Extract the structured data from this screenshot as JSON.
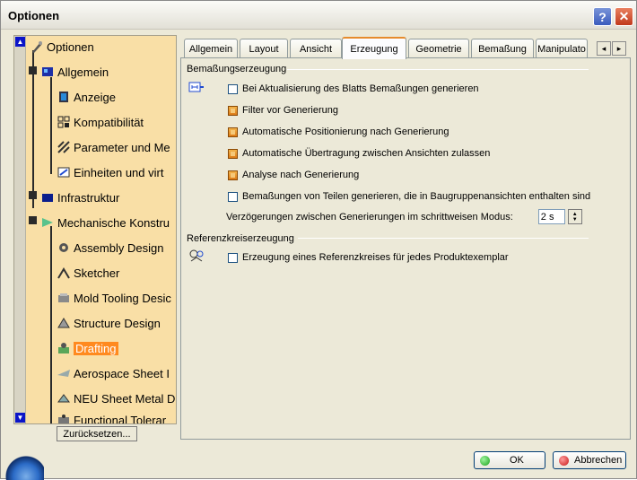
{
  "window": {
    "title": "Optionen",
    "help_label": "?",
    "close_label": "✕"
  },
  "tree": {
    "scroll_up": "▲",
    "scroll_down": "▼",
    "items": [
      {
        "label": "Optionen",
        "icon": "options-root-icon"
      },
      {
        "label": "Allgemein",
        "icon": "general-icon"
      },
      {
        "label": "Anzeige",
        "icon": "display-icon"
      },
      {
        "label": "Kompatibilität",
        "icon": "compatibility-icon"
      },
      {
        "label": "Parameter und Me",
        "icon": "parameters-icon"
      },
      {
        "label": "Einheiten und virt",
        "icon": "units-icon"
      },
      {
        "label": "Infrastruktur",
        "icon": "infrastructure-icon"
      },
      {
        "label": "Mechanische Konstru",
        "icon": "mechanical-design-icon"
      },
      {
        "label": "Assembly Design",
        "icon": "assembly-design-icon"
      },
      {
        "label": "Sketcher",
        "icon": "sketcher-icon"
      },
      {
        "label": "Mold Tooling Desic",
        "icon": "mold-tooling-icon"
      },
      {
        "label": "Structure Design",
        "icon": "structure-design-icon"
      },
      {
        "label": "Drafting",
        "icon": "drafting-icon"
      },
      {
        "label": "Aerospace Sheet I",
        "icon": "aerospace-sheet-icon"
      },
      {
        "label": "NEU Sheet Metal D",
        "icon": "sheet-metal-icon"
      },
      {
        "label": "Functional Tolerar",
        "icon": "functional-tolerancing-icon"
      }
    ],
    "selected": "Drafting",
    "reset_label": "Zurücksetzen..."
  },
  "tabs": {
    "items": [
      "Allgemein",
      "Layout",
      "Ansicht",
      "Erzeugung",
      "Geometrie",
      "Bemaßung",
      "Manipulato"
    ],
    "active": "Erzeugung",
    "scroll_left": "◂",
    "scroll_right": "▸"
  },
  "panel": {
    "section1": {
      "title": "Bemaßungserzeugung",
      "options": [
        {
          "label": "Bei Aktualisierung des Blatts Bemaßungen generieren",
          "checked": false
        },
        {
          "label": "Filter vor Generierung",
          "checked": true
        },
        {
          "label": "Automatische Positionierung nach Generierung",
          "checked": true
        },
        {
          "label": "Automatische Übertragung zwischen Ansichten zulassen",
          "checked": true
        },
        {
          "label": "Analyse nach Generierung",
          "checked": true
        },
        {
          "label": "Bemaßungen von Teilen generieren, die in Baugruppenansichten enthalten sind",
          "checked": false
        }
      ],
      "delay_label": "Verzögerungen zwischen Generierungen im schrittweisen Modus:",
      "delay_value": "2 s"
    },
    "section2": {
      "title": "Referenzkreiserzeugung",
      "options": [
        {
          "label": "Erzeugung eines Referenzkreises für jedes Produktexemplar",
          "checked": false
        }
      ]
    }
  },
  "footer": {
    "ok_label": "OK",
    "cancel_label": "Abbrechen"
  },
  "colors": {
    "tree_bg": "#f9dfa6",
    "selected": "#ff8a1f",
    "tab_accent": "#e68b2c",
    "window_bg": "#ece9d8"
  }
}
